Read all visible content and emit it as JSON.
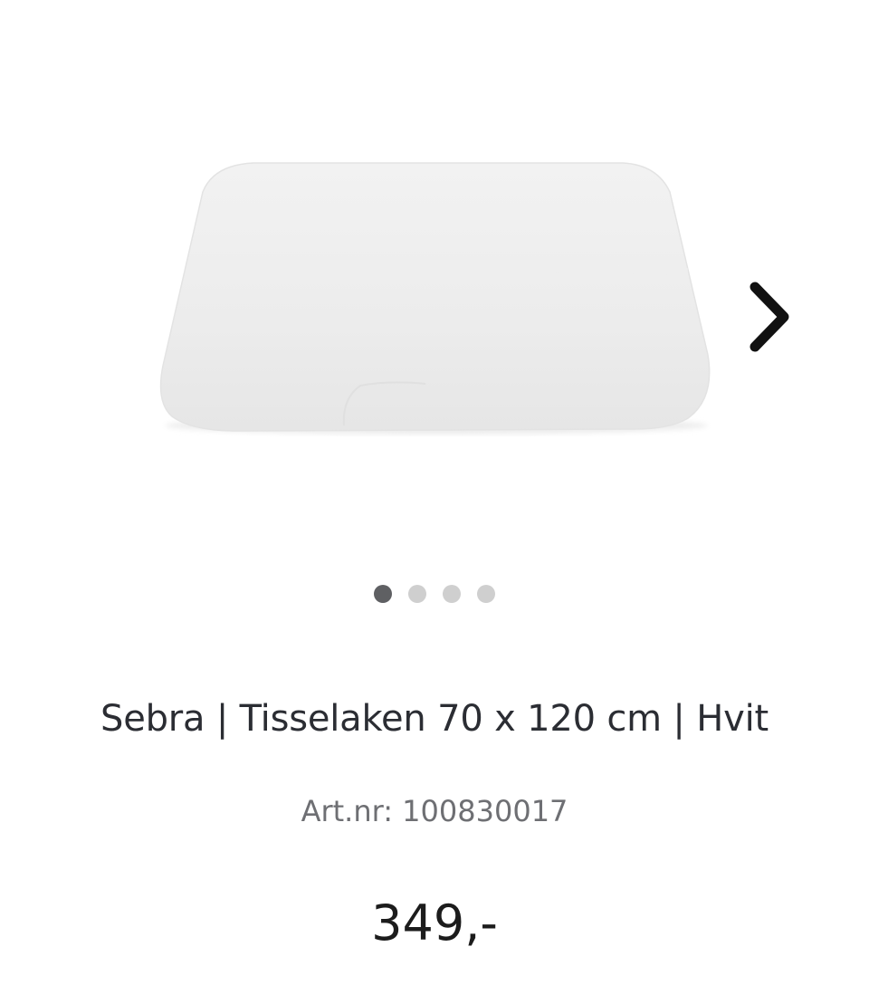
{
  "product": {
    "title": "Sebra | Tisselaken 70 x 120 cm | Hvit",
    "art_nr": "Art.nr: 100830017",
    "price": "349,-",
    "image_icon": "fitted-sheet-image"
  },
  "gallery": {
    "next_icon": "chevron-right-icon",
    "dot_count": 4,
    "active_index": 0
  },
  "colors": {
    "dot_active": "#5f6063",
    "dot_inactive": "#cfcfcf",
    "chevron": "#111111"
  }
}
